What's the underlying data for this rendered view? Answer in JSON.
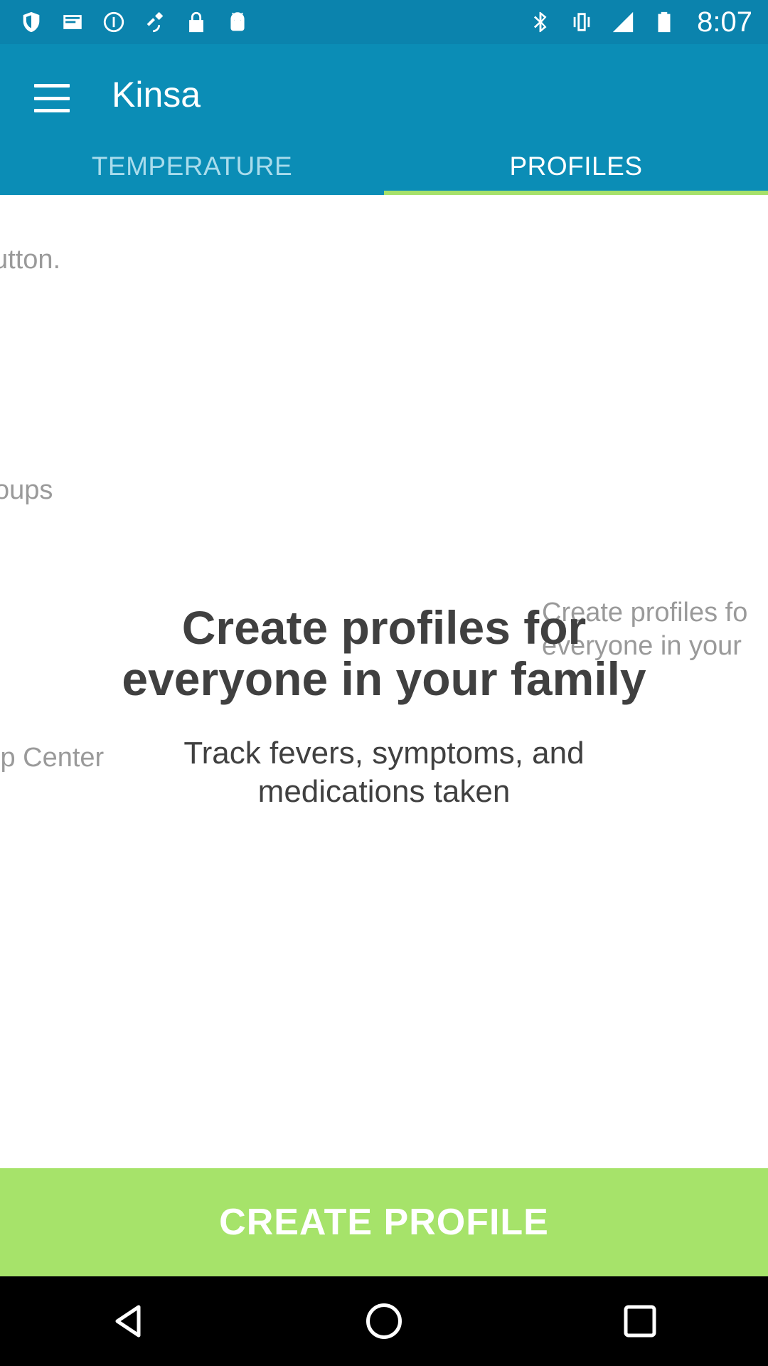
{
  "status_bar": {
    "time": "8:07",
    "left_icons": [
      "shield-icon",
      "mail-icon",
      "data-saver-icon",
      "satellite-icon",
      "lock-icon",
      "android-icon"
    ],
    "right_icons": [
      "bluetooth-icon",
      "vibrate-icon",
      "cellular-signal-icon",
      "battery-icon"
    ]
  },
  "app_bar": {
    "title": "Kinsa",
    "tabs": [
      {
        "label": "TEMPERATURE",
        "active": false
      },
      {
        "label": "PROFILES",
        "active": true
      }
    ]
  },
  "content": {
    "peek_texts": [
      "utton.",
      "oups",
      "lp Center",
      "Create profiles fo",
      "everyone in your"
    ],
    "headline_line1": "Create profiles for",
    "headline_line2": "everyone in your family",
    "subline_line1": "Track fevers, symptoms, and",
    "subline_line2": "medications taken"
  },
  "cta": {
    "label": "CREATE PROFILE"
  },
  "colors": {
    "status_bar": "#0b83ad",
    "app_bar": "#0b8db6",
    "accent_green": "#a6e36a",
    "text_dark": "#404040",
    "text_faded": "#9a9a9a"
  },
  "nav_bar": {
    "buttons": [
      "back-icon",
      "home-icon",
      "recents-icon"
    ]
  }
}
